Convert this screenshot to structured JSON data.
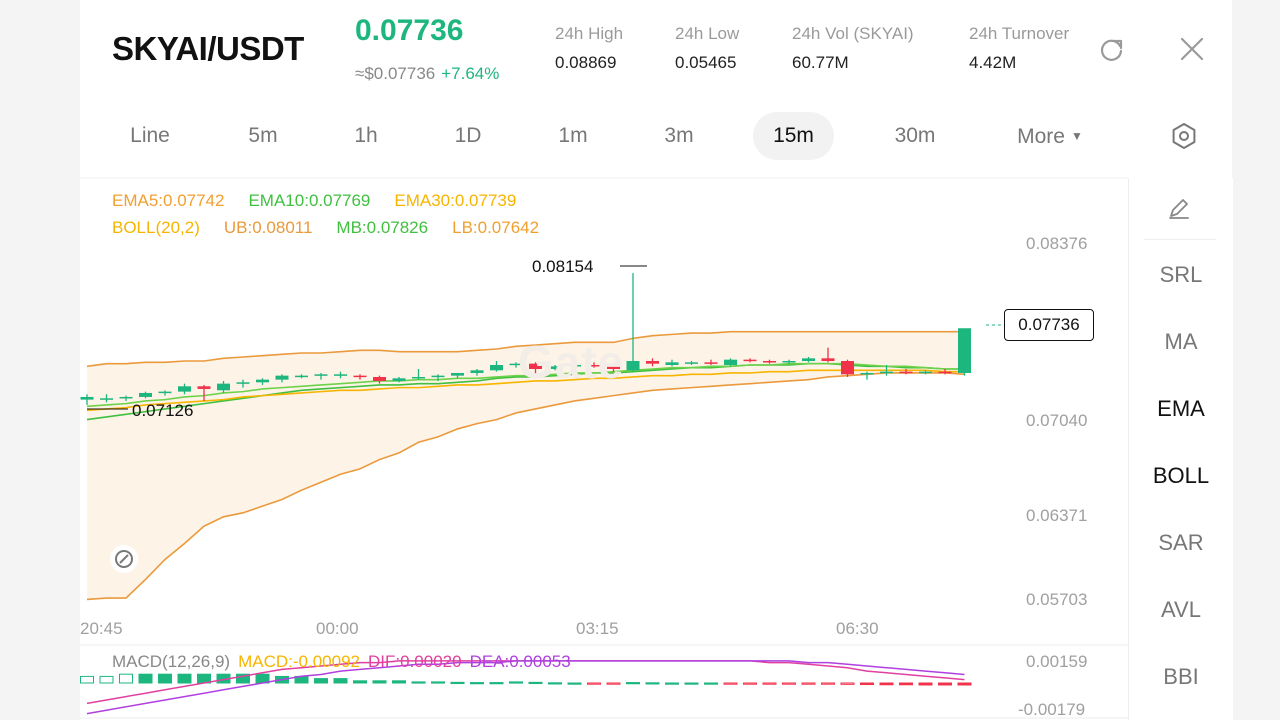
{
  "header": {
    "pair": "SKYAI/USDT",
    "price": "0.07736",
    "approx": "≈$0.07736",
    "change": "+7.64%",
    "stats": [
      {
        "label": "24h   High",
        "value": "0.08869"
      },
      {
        "label": "24h   Low",
        "value": "0.05465"
      },
      {
        "label": "24h   Vol (SKYAI)",
        "value": "60.77M"
      },
      {
        "label": "24h   Turnover",
        "value": "4.42M"
      }
    ],
    "icons": [
      "refresh-icon",
      "close-icon"
    ]
  },
  "tabs": [
    {
      "label": "Line"
    },
    {
      "label": "5m"
    },
    {
      "label": "1h"
    },
    {
      "label": "1D"
    },
    {
      "label": "1m"
    },
    {
      "label": "3m"
    },
    {
      "label": "15m",
      "active": true
    },
    {
      "label": "30m"
    },
    {
      "label": "More"
    }
  ],
  "sidebar": {
    "items": [
      "SRL",
      "MA",
      "EMA",
      "BOLL",
      "SAR",
      "AVL",
      "BBI"
    ],
    "active": [
      "EMA",
      "BOLL"
    ]
  },
  "indicators": {
    "ema5": "EMA5:0.07742",
    "ema10": "EMA10:0.07769",
    "ema30": "EMA30:0.07739",
    "boll": "BOLL(20,2)",
    "ub": "UB:0.08011",
    "mb": "MB:0.07826",
    "lb": "LB:0.07642"
  },
  "macd_legend": {
    "macd": "MACD(12,26,9)",
    "val": "MACD:-0.00092",
    "dif": "DIF:0.00020",
    "dea": "DEA:0.00053"
  },
  "colors": {
    "up": "#1eb67f",
    "down": "#f0324a",
    "ema5": "#f0a030",
    "ema10": "#40c040",
    "ema30": "#f7b500",
    "boll": "#ea9a3c",
    "dif": "#e040a0",
    "dea": "#b040e0"
  },
  "chart_data": {
    "type": "candlestick",
    "x_ticks": [
      "20:45",
      "00:00",
      "03:15",
      "06:30"
    ],
    "y_ticks": [
      "0.08376",
      "0.07040",
      "0.06371",
      "0.05703"
    ],
    "macd_y_ticks": [
      "0.00159",
      "-0.00179"
    ],
    "current_price": "0.07736",
    "high_marker": "0.08154",
    "low_marker": "0.07126",
    "ylim": [
      0.05703,
      0.08376
    ],
    "candles": [
      {
        "o": 0.072,
        "h": 0.0724,
        "l": 0.0716,
        "c": 0.0722
      },
      {
        "o": 0.072,
        "h": 0.0724,
        "l": 0.0718,
        "c": 0.0721
      },
      {
        "o": 0.0721,
        "h": 0.0723,
        "l": 0.0719,
        "c": 0.0722
      },
      {
        "o": 0.0722,
        "h": 0.0726,
        "l": 0.0721,
        "c": 0.0725
      },
      {
        "o": 0.0725,
        "h": 0.0727,
        "l": 0.0723,
        "c": 0.0726
      },
      {
        "o": 0.0726,
        "h": 0.0732,
        "l": 0.0724,
        "c": 0.073
      },
      {
        "o": 0.073,
        "h": 0.0731,
        "l": 0.0719,
        "c": 0.0728
      },
      {
        "o": 0.0727,
        "h": 0.0734,
        "l": 0.0725,
        "c": 0.0732
      },
      {
        "o": 0.0732,
        "h": 0.0735,
        "l": 0.0729,
        "c": 0.0733
      },
      {
        "o": 0.0733,
        "h": 0.0736,
        "l": 0.0731,
        "c": 0.0735
      },
      {
        "o": 0.0735,
        "h": 0.0739,
        "l": 0.0733,
        "c": 0.0738
      },
      {
        "o": 0.0738,
        "h": 0.0739,
        "l": 0.0736,
        "c": 0.0738
      },
      {
        "o": 0.0738,
        "h": 0.074,
        "l": 0.0735,
        "c": 0.0739
      },
      {
        "o": 0.0739,
        "h": 0.0741,
        "l": 0.0736,
        "c": 0.0739
      },
      {
        "o": 0.0738,
        "h": 0.0739,
        "l": 0.0735,
        "c": 0.0737
      },
      {
        "o": 0.0737,
        "h": 0.0738,
        "l": 0.0732,
        "c": 0.0734
      },
      {
        "o": 0.0734,
        "h": 0.0737,
        "l": 0.0733,
        "c": 0.0736
      },
      {
        "o": 0.0736,
        "h": 0.0743,
        "l": 0.0735,
        "c": 0.0737
      },
      {
        "o": 0.0737,
        "h": 0.0739,
        "l": 0.0734,
        "c": 0.0738
      },
      {
        "o": 0.0738,
        "h": 0.074,
        "l": 0.0736,
        "c": 0.074
      },
      {
        "o": 0.074,
        "h": 0.0743,
        "l": 0.0738,
        "c": 0.0742
      },
      {
        "o": 0.0742,
        "h": 0.0749,
        "l": 0.0741,
        "c": 0.0746
      },
      {
        "o": 0.0746,
        "h": 0.0748,
        "l": 0.0744,
        "c": 0.0747
      },
      {
        "o": 0.0747,
        "h": 0.0748,
        "l": 0.0737,
        "c": 0.0743
      },
      {
        "o": 0.0743,
        "h": 0.0746,
        "l": 0.0742,
        "c": 0.0745
      },
      {
        "o": 0.0745,
        "h": 0.0747,
        "l": 0.0744,
        "c": 0.0746
      },
      {
        "o": 0.0746,
        "h": 0.0748,
        "l": 0.0744,
        "c": 0.0745
      },
      {
        "o": 0.0745,
        "h": 0.0747,
        "l": 0.0741,
        "c": 0.0743
      },
      {
        "o": 0.0742,
        "h": 0.0815,
        "l": 0.0741,
        "c": 0.0749
      },
      {
        "o": 0.0749,
        "h": 0.0751,
        "l": 0.0745,
        "c": 0.0747
      },
      {
        "o": 0.0746,
        "h": 0.075,
        "l": 0.0745,
        "c": 0.0748
      },
      {
        "o": 0.0748,
        "h": 0.0749,
        "l": 0.0746,
        "c": 0.0748
      },
      {
        "o": 0.0748,
        "h": 0.075,
        "l": 0.0746,
        "c": 0.0747
      },
      {
        "o": 0.0746,
        "h": 0.0751,
        "l": 0.0745,
        "c": 0.075
      },
      {
        "o": 0.075,
        "h": 0.0751,
        "l": 0.0748,
        "c": 0.0749
      },
      {
        "o": 0.0749,
        "h": 0.075,
        "l": 0.0747,
        "c": 0.0748
      },
      {
        "o": 0.0748,
        "h": 0.075,
        "l": 0.0747,
        "c": 0.0749
      },
      {
        "o": 0.0749,
        "h": 0.0752,
        "l": 0.0748,
        "c": 0.0751
      },
      {
        "o": 0.0751,
        "h": 0.0759,
        "l": 0.0748,
        "c": 0.0749
      },
      {
        "o": 0.0749,
        "h": 0.075,
        "l": 0.0737,
        "c": 0.0739
      },
      {
        "o": 0.0739,
        "h": 0.0741,
        "l": 0.0735,
        "c": 0.074
      },
      {
        "o": 0.074,
        "h": 0.0746,
        "l": 0.0738,
        "c": 0.0741
      },
      {
        "o": 0.0741,
        "h": 0.0743,
        "l": 0.0739,
        "c": 0.074
      },
      {
        "o": 0.074,
        "h": 0.0742,
        "l": 0.0739,
        "c": 0.0741
      },
      {
        "o": 0.0741,
        "h": 0.0743,
        "l": 0.0739,
        "c": 0.074
      },
      {
        "o": 0.074,
        "h": 0.0741,
        "l": 0.0738,
        "c": 0.07736
      }
    ],
    "boll_ub": [
      0.0745,
      0.0747,
      0.0747,
      0.0748,
      0.0748,
      0.0749,
      0.0749,
      0.0751,
      0.0752,
      0.0753,
      0.0754,
      0.0755,
      0.0755,
      0.0756,
      0.0757,
      0.0757,
      0.0756,
      0.0756,
      0.0756,
      0.0756,
      0.0757,
      0.0758,
      0.076,
      0.0761,
      0.0762,
      0.0763,
      0.0763,
      0.0763,
      0.0766,
      0.0768,
      0.0769,
      0.077,
      0.077,
      0.0771,
      0.0771,
      0.0771,
      0.0771,
      0.0771,
      0.0771,
      0.0771,
      0.0771,
      0.0771,
      0.0771,
      0.0771,
      0.0771,
      0.0771
    ],
    "boll_mb": [
      0.0715,
      0.0716,
      0.0717,
      0.0719,
      0.072,
      0.0722,
      0.0723,
      0.0725,
      0.0726,
      0.0728,
      0.0729,
      0.073,
      0.0731,
      0.0732,
      0.0733,
      0.0734,
      0.0734,
      0.0735,
      0.0735,
      0.0736,
      0.0736,
      0.0737,
      0.0738,
      0.0738,
      0.0739,
      0.074,
      0.074,
      0.0741,
      0.0742,
      0.0743,
      0.0744,
      0.0744,
      0.0745,
      0.0745,
      0.0746,
      0.0746,
      0.0747,
      0.0747,
      0.0747,
      0.0747,
      0.0746,
      0.0745,
      0.0745,
      0.0744,
      0.0743,
      0.0743
    ],
    "boll_lb": [
      0.057,
      0.0571,
      0.0571,
      0.0585,
      0.06,
      0.0612,
      0.0625,
      0.0632,
      0.0635,
      0.064,
      0.0645,
      0.0652,
      0.0658,
      0.0664,
      0.0668,
      0.0675,
      0.068,
      0.0688,
      0.0692,
      0.0698,
      0.0702,
      0.0705,
      0.071,
      0.0713,
      0.0716,
      0.0719,
      0.0721,
      0.0723,
      0.0725,
      0.0727,
      0.0728,
      0.0729,
      0.073,
      0.0731,
      0.0732,
      0.0733,
      0.0734,
      0.0735,
      0.0737,
      0.0738,
      0.0739,
      0.074,
      0.074,
      0.074,
      0.074,
      0.0739
    ],
    "ema10": [
      0.0705,
      0.0707,
      0.0709,
      0.0711,
      0.0713,
      0.0715,
      0.0717,
      0.0719,
      0.0721,
      0.0723,
      0.0725,
      0.0727,
      0.0728,
      0.0729,
      0.073,
      0.0731,
      0.0731,
      0.0732,
      0.0732,
      0.0733,
      0.0734,
      0.0736,
      0.0737,
      0.0737,
      0.0738,
      0.0739,
      0.074,
      0.074,
      0.0741,
      0.0742,
      0.0743,
      0.0744,
      0.0744,
      0.0745,
      0.0746,
      0.0746,
      0.0746,
      0.0747,
      0.0747,
      0.0746,
      0.0745,
      0.0745,
      0.0744,
      0.0744,
      0.0743,
      0.0743
    ],
    "ema30": [
      0.0712,
      0.0713,
      0.0714,
      0.0716,
      0.0717,
      0.0718,
      0.0719,
      0.072,
      0.0722,
      0.0723,
      0.0724,
      0.0725,
      0.0726,
      0.0727,
      0.0727,
      0.0728,
      0.0729,
      0.0729,
      0.073,
      0.0731,
      0.0731,
      0.0732,
      0.0733,
      0.0734,
      0.0734,
      0.0735,
      0.0736,
      0.0736,
      0.0737,
      0.0738,
      0.0738,
      0.0739,
      0.0739,
      0.074,
      0.074,
      0.0741,
      0.0741,
      0.0742,
      0.0742,
      0.0742,
      0.0742,
      0.0742,
      0.0742,
      0.0742,
      0.0741,
      0.0741
    ],
    "macd_hist": [
      0.0003,
      0.0003,
      0.0004,
      0.0004,
      0.0004,
      0.0004,
      0.0004,
      0.0004,
      0.0004,
      0.0004,
      0.0003,
      0.0003,
      0.0002,
      0.0002,
      0.0001,
      0.0001,
      0.0001,
      5e-05,
      5e-05,
      3e-05,
      2e-05,
      2e-05,
      5e-05,
      3e-05,
      1e-05,
      0.0,
      -1e-05,
      -2e-05,
      2e-05,
      1e-05,
      0.0,
      0.0,
      0.0,
      -1e-05,
      -2e-05,
      -2e-05,
      -3e-05,
      -4e-05,
      -5e-05,
      -6e-05,
      -7e-05,
      -8e-05,
      -8e-05,
      -9e-05,
      -9e-05,
      -9e-05
    ],
    "macd_dif": [
      -0.0012,
      -0.001,
      -0.0008,
      -0.0006,
      -0.0004,
      -0.0002,
      0.0,
      0.0002,
      0.0004,
      0.0006,
      0.0008,
      0.0009,
      0.001,
      0.0011,
      0.0012,
      0.0012,
      0.0013,
      0.0013,
      0.0013,
      0.0013,
      0.0013,
      0.0013,
      0.0013,
      0.0013,
      0.0013,
      0.0013,
      0.0013,
      0.0013,
      0.0013,
      0.0013,
      0.0013,
      0.0013,
      0.0013,
      0.0013,
      0.0013,
      0.0012,
      0.0012,
      0.0011,
      0.001,
      0.0009,
      0.0007,
      0.0006,
      0.0005,
      0.0004,
      0.0003,
      0.0002
    ],
    "macd_dea": [
      -0.0018,
      -0.0016,
      -0.0014,
      -0.0012,
      -0.001,
      -0.0008,
      -0.0006,
      -0.0004,
      -0.0002,
      0.0,
      0.0002,
      0.0004,
      0.0005,
      0.0007,
      0.0008,
      0.0009,
      0.001,
      0.0011,
      0.0011,
      0.0012,
      0.0012,
      0.0012,
      0.0013,
      0.0013,
      0.0013,
      0.0013,
      0.0013,
      0.0013,
      0.0013,
      0.0013,
      0.0013,
      0.0013,
      0.0013,
      0.0013,
      0.0013,
      0.0013,
      0.0013,
      0.0012,
      0.0012,
      0.0011,
      0.001,
      0.0009,
      0.0008,
      0.0007,
      0.0006,
      0.0005
    ]
  }
}
